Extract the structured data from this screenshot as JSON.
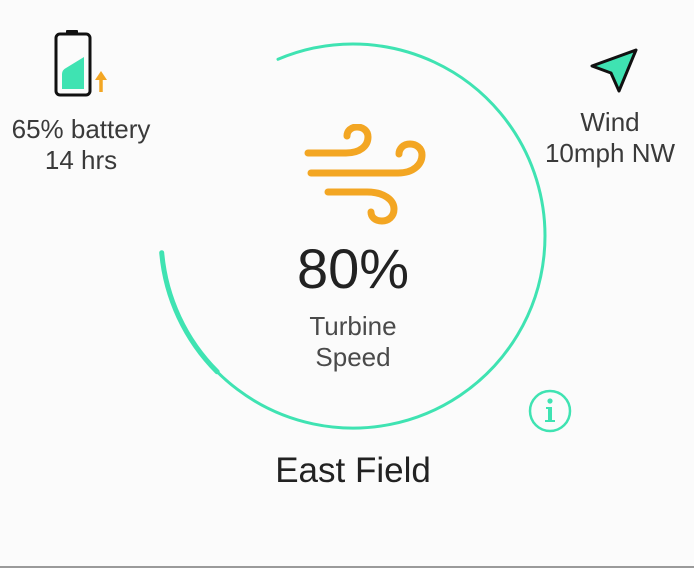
{
  "battery": {
    "percent_text": "65% battery",
    "time_text": "14 hrs",
    "level": 0.65,
    "charging": true,
    "icon": "battery-charging-icon"
  },
  "wind": {
    "label": "Wind",
    "value": "10mph NW",
    "icon": "navigation-arrow-icon"
  },
  "turbine": {
    "speed_text": "80%",
    "speed": 0.8,
    "label_line1": "Turbine",
    "label_line2": "Speed",
    "icon": "wind-icon"
  },
  "field": {
    "name": "East Field"
  },
  "info": {
    "icon": "info-icon"
  },
  "colors": {
    "accent": "#3fe3b2",
    "wind_icon": "#f3a623",
    "text": "#333333",
    "background": "#fbfbfb"
  }
}
